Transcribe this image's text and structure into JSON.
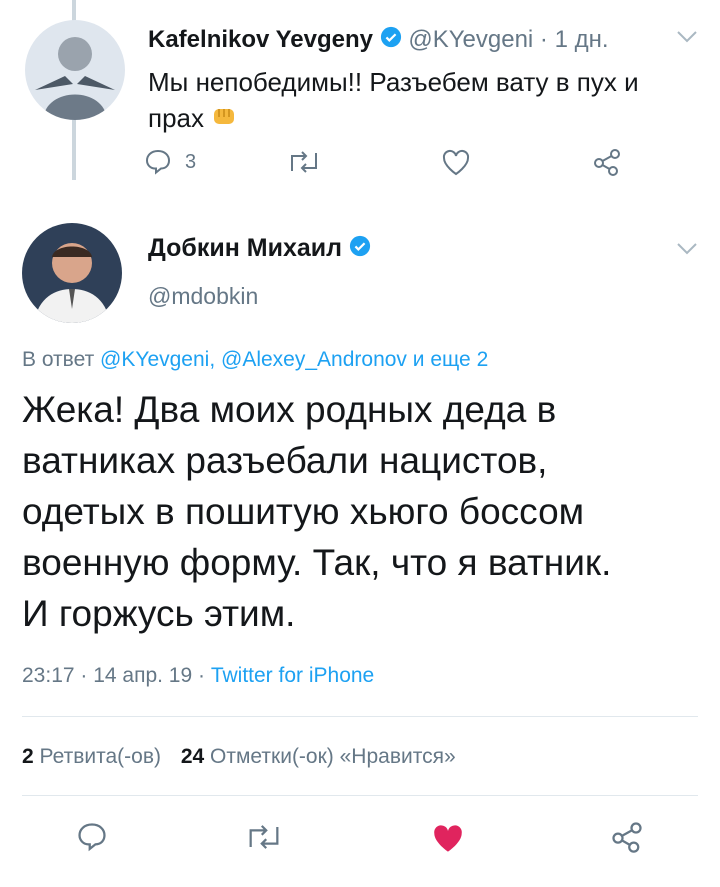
{
  "reply_tweet": {
    "author_name": "Kafelnikov Yevgeny",
    "handle": "@KYevgeni",
    "time_sep": " · ",
    "time": "1 дн.",
    "text": "Мы непобедимы!! Разъебем вату в пух и прах",
    "emoji": "fist-emoji",
    "reply_count": "3"
  },
  "main_tweet": {
    "author_name": "Добкин Михаил",
    "handle": "@mdobkin",
    "reply_to_prefix": "В ответ ",
    "reply_to_users": "@KYevgeni, @Alexey_Andronov",
    "reply_to_suffix": " и еще 2",
    "text_lines": [
      "Жека! Два моих родных деда в",
      "ватниках разъебали нацистов,",
      "одетых в пошитую хьюго боссом",
      "военную форму. Так, что я ватник.",
      "И горжусь этим."
    ],
    "timestamp": "23:17 · 14 апр. 19 · ",
    "source": "Twitter for iPhone",
    "retweet_count": "2",
    "retweet_label": "Ретвита(-ов)",
    "like_count": "24",
    "like_label": "Отметки(-ок) «Нравится»"
  },
  "colors": {
    "accent": "#1da1f2",
    "like": "#e0245e",
    "muted": "#657786",
    "divider": "#e1e8ed"
  }
}
